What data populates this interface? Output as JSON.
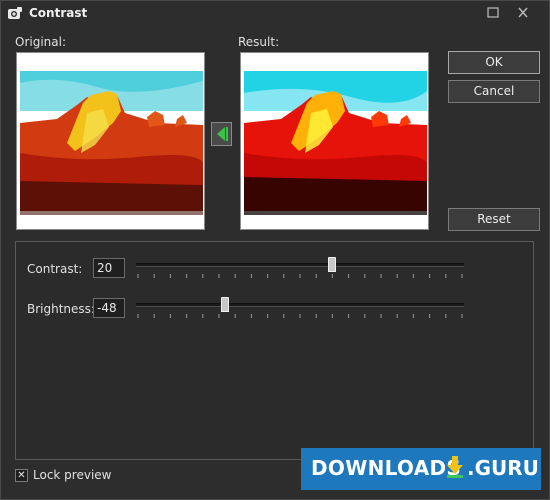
{
  "window": {
    "title": "Contrast",
    "maximize_icon": "maximize-icon",
    "close_icon": "close-icon"
  },
  "previews": {
    "original_label": "Original:",
    "result_label": "Result:"
  },
  "buttons": {
    "ok": "OK",
    "cancel": "Cancel",
    "reset": "Reset"
  },
  "controls": {
    "contrast": {
      "label": "Contrast:",
      "value": "20",
      "level": 0.6
    },
    "brightness": {
      "label": "Brightness:",
      "value": "-48",
      "level": 0.265
    }
  },
  "lock_preview": {
    "label": "Lock preview",
    "checked": true
  },
  "watermark": {
    "text": "DOWNLOADS",
    "suffix": ".GURU"
  },
  "colors": {
    "background": "#2d2d2d",
    "accent_arrow": "#3cc24a",
    "watermark_blue": "#1d78bd",
    "watermark_yellow": "#f2c314"
  }
}
